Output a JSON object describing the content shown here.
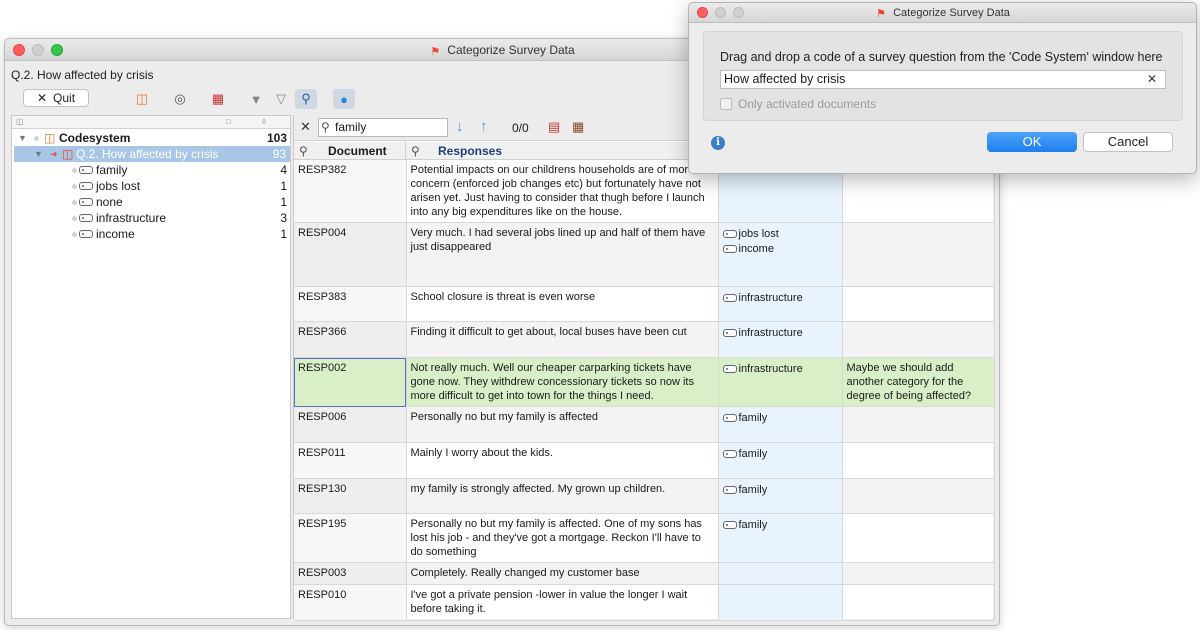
{
  "main_window": {
    "title": "Categorize Survey Data",
    "question_label": "Q.2. How affected by crisis",
    "quit_label": "Quit"
  },
  "tree": {
    "root": {
      "label": "Codesystem",
      "count": "103"
    },
    "question": {
      "label": "Q.2. How affected by crisis",
      "count": "93"
    },
    "codes": [
      {
        "label": "family",
        "count": "4"
      },
      {
        "label": "jobs lost",
        "count": "1"
      },
      {
        "label": "none",
        "count": "1"
      },
      {
        "label": "infrastructure",
        "count": "3"
      },
      {
        "label": "income",
        "count": "1"
      }
    ]
  },
  "search": {
    "value": "family",
    "counter": "0/0"
  },
  "columns": {
    "document": "Document",
    "responses": "Responses"
  },
  "rows": [
    {
      "doc": "RESP382",
      "response": "Potential impacts on our childrens households are of more concern (enforced job changes etc) but fortunately have not arisen yet. Just having to consider that thugh before I launch into any big expenditures like on the house.",
      "codes": [],
      "memo": ""
    },
    {
      "doc": "RESP004",
      "response": "Very much. I had several jobs lined up and half of them have just disappeared",
      "codes": [
        "jobs lost",
        "income"
      ],
      "memo": ""
    },
    {
      "doc": "RESP383",
      "response": "School closure is threat is even worse",
      "codes": [
        "infrastructure"
      ],
      "memo": ""
    },
    {
      "doc": "RESP366",
      "response": "Finding it difficult to get about, local buses have been cut",
      "codes": [
        "infrastructure"
      ],
      "memo": ""
    },
    {
      "doc": "RESP002",
      "response": "Not really much. Well our cheaper carparking tickets have gone now. They withdrew concessionary tickets so now its more difficult to get into town for the things I need.",
      "codes": [
        "infrastructure"
      ],
      "memo": "Maybe we should add another category for the degree of being affected?"
    },
    {
      "doc": "RESP006",
      "response": "Personally no but my family is affected",
      "codes": [
        "family"
      ],
      "memo": ""
    },
    {
      "doc": "RESP011",
      "response": "Mainly I worry about the kids.",
      "codes": [
        "family"
      ],
      "memo": ""
    },
    {
      "doc": "RESP130",
      "response": "my family is strongly affected. My grown up children.",
      "codes": [
        "family"
      ],
      "memo": ""
    },
    {
      "doc": "RESP195",
      "response": "Personally no but my family is affected. One of my sons has lost his job - and they've got a mortgage. Reckon I'll have to do something",
      "codes": [
        "family"
      ],
      "memo": ""
    },
    {
      "doc": "RESP003",
      "response": "Completely. Really changed my customer base",
      "codes": [],
      "memo": ""
    },
    {
      "doc": "RESP010",
      "response": "I've got a private  pension -lower in value the longer I wait before taking it.",
      "codes": [],
      "memo": ""
    }
  ],
  "dialog": {
    "title": "Categorize Survey Data",
    "instruction": "Drag and drop a code of a survey question from the 'Code System' window here",
    "input_value": "How affected by crisis",
    "checkbox_label": "Only activated documents",
    "ok_label": "OK",
    "cancel_label": "Cancel"
  },
  "colors": {
    "selection": "#a8c6e6",
    "highlight_row": "#d9efc8",
    "codes_column": "#e8f3fe",
    "ok_button": "#1f7ff0"
  }
}
